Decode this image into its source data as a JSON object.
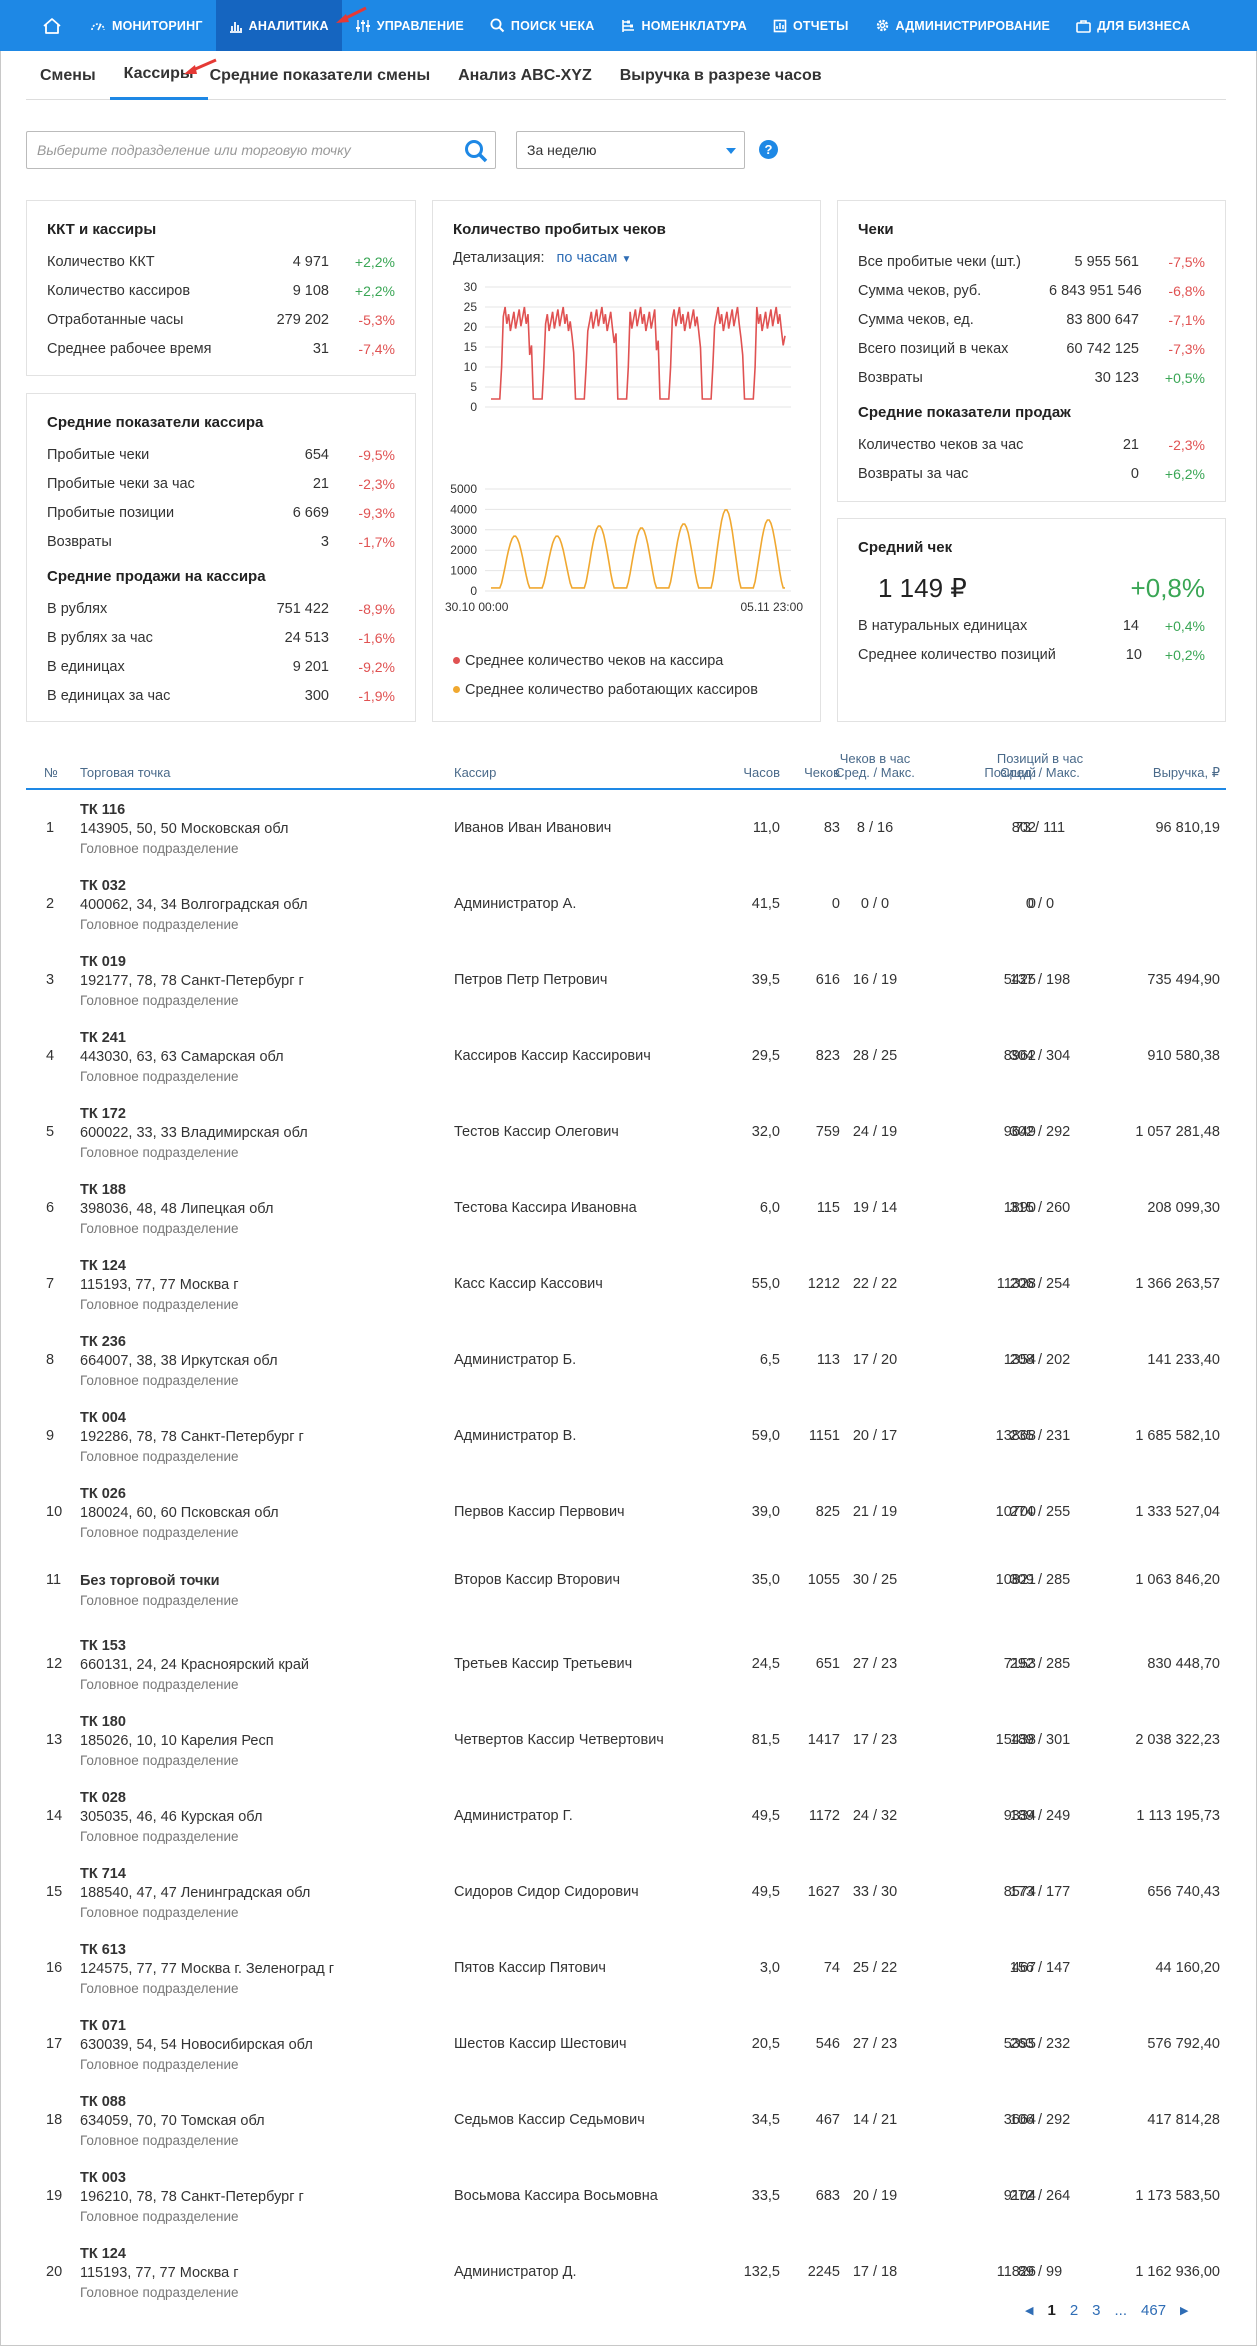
{
  "nav": {
    "items": [
      {
        "label": "МОНИТОРИНГ",
        "icon": "gauge-icon"
      },
      {
        "label": "АНАЛИТИКА",
        "icon": "bar-chart-icon"
      },
      {
        "label": "УПРАВЛЕНИЕ",
        "icon": "sliders-icon"
      },
      {
        "label": "ПОИСК ЧЕКА",
        "icon": "search-icon"
      },
      {
        "label": "НОМЕНКЛАТУРА",
        "icon": "nomenclature-icon"
      },
      {
        "label": "ОТЧЕТЫ",
        "icon": "reports-icon"
      },
      {
        "label": "АДМИНИСТРИРОВАНИЕ",
        "icon": "gear-icon"
      },
      {
        "label": "ДЛЯ БИЗНЕСА",
        "icon": "briefcase-icon"
      }
    ]
  },
  "subtabs": [
    "Смены",
    "Кассиры",
    "Средние показатели смены",
    "Анализ ABC-XYZ",
    "Выручка в разрезе часов"
  ],
  "filters": {
    "search_placeholder": "Выберите подразделение или торговую точку",
    "period": "За неделю",
    "help": "?"
  },
  "kkt": {
    "title": "ККТ и кассиры",
    "rows": [
      {
        "label": "Количество ККТ",
        "value": "4 971",
        "pct": "+2,2%"
      },
      {
        "label": "Количество кассиров",
        "value": "9 108",
        "pct": "+2,2%"
      },
      {
        "label": "Отработанные часы",
        "value": "279 202",
        "pct": "-5,3%"
      },
      {
        "label": "Среднее рабочее время",
        "value": "31",
        "pct": "-7,4%"
      }
    ]
  },
  "cashier_avg": {
    "title": "Средние показатели кассира",
    "rows": [
      {
        "label": "Пробитые чеки",
        "value": "654",
        "pct": "-9,5%"
      },
      {
        "label": "Пробитые чеки за час",
        "value": "21",
        "pct": "-2,3%"
      },
      {
        "label": "Пробитые позиции",
        "value": "6 669",
        "pct": "-9,3%"
      },
      {
        "label": "Возвраты",
        "value": "3",
        "pct": "-1,7%"
      }
    ],
    "title2": "Средние продажи на кассира",
    "rows2": [
      {
        "label": "В рублях",
        "value": "751 422",
        "pct": "-8,9%"
      },
      {
        "label": "В рублях за час",
        "value": "24 513",
        "pct": "-1,6%"
      },
      {
        "label": "В единицах",
        "value": "9 201",
        "pct": "-9,2%"
      },
      {
        "label": "В единицах за час",
        "value": "300",
        "pct": "-1,9%"
      }
    ]
  },
  "chart_card": {
    "title": "Количество пробитых чеков",
    "detail_label": "Детализация:",
    "detail_value": "по часам",
    "x_start": "30.10 00:00",
    "x_end": "05.11 23:00"
  },
  "chart_data": [
    {
      "type": "line",
      "color": "#e05252",
      "series": [
        {
          "name": "Среднее количество чеков на кассира"
        }
      ],
      "ylim": [
        0,
        30
      ],
      "yticks": [
        0,
        5,
        10,
        15,
        20,
        25,
        30
      ],
      "x": [
        "30.10 00:00",
        "05.11 23:00"
      ],
      "daily_pattern_low": 2,
      "daily_pattern_high": 25
    },
    {
      "type": "line",
      "color": "#f0a830",
      "series": [
        {
          "name": "Среднее количество работающих кассиров"
        }
      ],
      "ylim": [
        0,
        5000
      ],
      "yticks": [
        0,
        1000,
        2000,
        3000,
        4000,
        5000
      ],
      "x": [
        "30.10 00:00",
        "05.11 23:00"
      ],
      "daily_peaks": [
        2700,
        2700,
        3200,
        3100,
        3300,
        4000,
        3500
      ]
    }
  ],
  "checks": {
    "title": "Чеки",
    "rows": [
      {
        "label": "Все пробитые чеки (шт.)",
        "value": "5 955 561",
        "pct": "-7,5%"
      },
      {
        "label": "Сумма чеков, руб.",
        "value": "6 843 951 546",
        "pct": "-6,8%"
      },
      {
        "label": "Сумма чеков, ед.",
        "value": "83 800 647",
        "pct": "-7,1%"
      },
      {
        "label": "Всего позиций в чеках",
        "value": "60 742 125",
        "pct": "-7,3%"
      },
      {
        "label": "Возвраты",
        "value": "30 123",
        "pct": "+0,5%"
      }
    ],
    "title2": "Средние показатели продаж",
    "rows2": [
      {
        "label": "Количество чеков за час",
        "value": "21",
        "pct": "-2,3%"
      },
      {
        "label": "Возвраты за час",
        "value": "0",
        "pct": "+6,2%"
      }
    ]
  },
  "avg_check": {
    "title": "Средний чек",
    "value": "1 149 ₽",
    "pct": "+0,8%",
    "rows": [
      {
        "label": "В натуральных единицах",
        "value": "14",
        "pct": "+0,4%"
      },
      {
        "label": "Среднее количество позиций",
        "value": "10",
        "pct": "+0,2%"
      }
    ]
  },
  "table": {
    "headers": {
      "num": "№",
      "point": "Торговая точка",
      "cashier": "Кассир",
      "hours": "Часов",
      "checks": "Чеков",
      "cph1": "Чеков в час",
      "cph2": "Сред. / Макс.",
      "positions": "Позиций",
      "pph1": "Позиций в час",
      "pph2": "Сред. / Макс.",
      "revenue": "Выручка, ₽"
    },
    "rows": [
      {
        "n": "1",
        "tp": "ТК 116",
        "addr": "143905, 50, 50 Московская обл",
        "div": "Головное подразделение",
        "cashier": "Иванов Иван Иванович",
        "hours": "11,0",
        "checks": "83",
        "cph": "8 / 16",
        "pos": "802",
        "pph": "73 / 111",
        "rev": "96 810,19"
      },
      {
        "n": "2",
        "tp": "ТК 032",
        "addr": "400062, 34, 34 Волгоградская обл",
        "div": "Головное подразделение",
        "cashier": "Администратор А.",
        "hours": "41,5",
        "checks": "0",
        "cph": "0 / 0",
        "pos": "0",
        "pph": "0 / 0",
        "rev": ""
      },
      {
        "n": "3",
        "tp": "ТК 019",
        "addr": "192177, 78, 78 Санкт-Петербург г",
        "div": "Головное подразделение",
        "cashier": "Петров Петр Петрович",
        "hours": "39,5",
        "checks": "616",
        "cph": "16 / 19",
        "pos": "5425",
        "pph": "137 / 198",
        "rev": "735 494,90"
      },
      {
        "n": "4",
        "tp": "ТК 241",
        "addr": "443030, 63, 63 Самарская обл",
        "div": "Головное подразделение",
        "cashier": "Кассиров Кассир Кассирович",
        "hours": "29,5",
        "checks": "823",
        "cph": "28 / 25",
        "pos": "8962",
        "pph": "304 / 304",
        "rev": "910 580,38"
      },
      {
        "n": "5",
        "tp": "ТК 172",
        "addr": "600022, 33, 33 Владимирская обл",
        "div": "Головное подразделение",
        "cashier": "Тестов Кассир Олегович",
        "hours": "32,0",
        "checks": "759",
        "cph": "24 / 19",
        "pos": "9649",
        "pph": "302 / 292",
        "rev": "1 057 281,48"
      },
      {
        "n": "6",
        "tp": "ТК 188",
        "addr": "398036, 48, 48 Липецкая обл",
        "div": "Головное подразделение",
        "cashier": "Тестова Кассира Ивановна",
        "hours": "6,0",
        "checks": "115",
        "cph": "19 / 14",
        "pos": "1890",
        "pph": "315 / 260",
        "rev": "208 099,30"
      },
      {
        "n": "7",
        "tp": "ТК 124",
        "addr": "115193, 77, 77 Москва г",
        "div": "Головное подразделение",
        "cashier": "Касс Кассир Кассович",
        "hours": "55,0",
        "checks": "1212",
        "cph": "22 / 22",
        "pos": "11328",
        "pph": "206 / 254",
        "rev": "1 366 263,57"
      },
      {
        "n": "8",
        "tp": "ТК 236",
        "addr": "664007, 38, 38 Иркутская обл",
        "div": "Головное подразделение",
        "cashier": "Администратор Б.",
        "hours": "6,5",
        "checks": "113",
        "cph": "17 / 20",
        "pos": "1354",
        "pph": "208 / 202",
        "rev": "141 233,40"
      },
      {
        "n": "9",
        "tp": "ТК 004",
        "addr": "192286, 78, 78 Санкт-Петербург г",
        "div": "Головное подразделение",
        "cashier": "Администратор В.",
        "hours": "59,0",
        "checks": "1151",
        "cph": "20 / 17",
        "pos": "13868",
        "pph": "235 / 231",
        "rev": "1 685 582,10"
      },
      {
        "n": "10",
        "tp": "ТК 026",
        "addr": "180024, 60, 60 Псковская обл",
        "div": "Головное подразделение",
        "cashier": "Первов Кассир Первович",
        "hours": "39,0",
        "checks": "825",
        "cph": "21 / 19",
        "pos": "10700",
        "pph": "274 / 255",
        "rev": "1 333 527,04"
      },
      {
        "n": "11",
        "tp": "Без торговой точки",
        "addr": "",
        "div": "Головное подразделение",
        "cashier": "Второв Кассир Вторович",
        "hours": "35,0",
        "checks": "1055",
        "cph": "30 / 25",
        "pos": "10821",
        "pph": "309 / 285",
        "rev": "1 063 846,20"
      },
      {
        "n": "12",
        "tp": "ТК 153",
        "addr": "660131, 24, 24 Красноярский край",
        "div": "Головное подразделение",
        "cashier": "Третьев Кассир Третьевич",
        "hours": "24,5",
        "checks": "651",
        "cph": "27 / 23",
        "pos": "7153",
        "pph": "292 / 285",
        "rev": "830 448,70"
      },
      {
        "n": "13",
        "tp": "ТК 180",
        "addr": "185026, 10, 10 Карелия Респ",
        "div": "Головное подразделение",
        "cashier": "Четвертов Кассир Четвертович",
        "hours": "81,5",
        "checks": "1417",
        "cph": "17 / 23",
        "pos": "15438",
        "pph": "189 / 301",
        "rev": "2 038 322,23"
      },
      {
        "n": "14",
        "tp": "ТК 028",
        "addr": "305035, 46, 46 Курская обл",
        "div": "Головное подразделение",
        "cashier": "Администратор Г.",
        "hours": "49,5",
        "checks": "1172",
        "cph": "24 / 32",
        "pos": "9334",
        "pph": "189 / 249",
        "rev": "1 113 195,73"
      },
      {
        "n": "15",
        "tp": "ТК 714",
        "addr": "188540, 47, 47 Ленинградская обл",
        "div": "Головное подразделение",
        "cashier": "Сидоров Сидор Сидорович",
        "hours": "49,5",
        "checks": "1627",
        "cph": "33 / 30",
        "pos": "8574",
        "pph": "173 / 177",
        "rev": "656 740,43"
      },
      {
        "n": "16",
        "tp": "ТК 613",
        "addr": "124575, 77, 77 Москва г. Зеленоград г",
        "div": "Головное подразделение",
        "cashier": "Пятов Кассир Пятович",
        "hours": "3,0",
        "checks": "74",
        "cph": "25 / 22",
        "pos": "467",
        "pph": "156 / 147",
        "rev": "44 160,20"
      },
      {
        "n": "17",
        "tp": "ТК 071",
        "addr": "630039, 54, 54 Новосибирская обл",
        "div": "Головное подразделение",
        "cashier": "Шестов Кассир Шестович",
        "hours": "20,5",
        "checks": "546",
        "cph": "27 / 23",
        "pos": "5395",
        "pph": "263 / 232",
        "rev": "576 792,40"
      },
      {
        "n": "18",
        "tp": "ТК 088",
        "addr": "634059, 70, 70 Томская обл",
        "div": "Головное подразделение",
        "cashier": "Седьмов Кассир Седьмович",
        "hours": "34,5",
        "checks": "467",
        "cph": "14 / 21",
        "pos": "3664",
        "pph": "106 / 292",
        "rev": "417 814,28"
      },
      {
        "n": "19",
        "tp": "ТК 003",
        "addr": "196210, 78, 78 Санкт-Петербург г",
        "div": "Головное подразделение",
        "cashier": "Восьмова Кассира Восьмовна",
        "hours": "33,5",
        "checks": "683",
        "cph": "20 / 19",
        "pos": "9104",
        "pph": "272 / 264",
        "rev": "1 173 583,50"
      },
      {
        "n": "20",
        "tp": "ТК 124",
        "addr": "115193, 77, 77 Москва г",
        "div": "Головное подразделение",
        "cashier": "Администратор Д.",
        "hours": "132,5",
        "checks": "2245",
        "cph": "17 / 18",
        "pos": "11826",
        "pph": "89 / 99",
        "rev": "1 162 936,00"
      }
    ]
  },
  "pager": {
    "pages": [
      "1",
      "2",
      "3",
      "...",
      "467"
    ],
    "current": "1"
  }
}
